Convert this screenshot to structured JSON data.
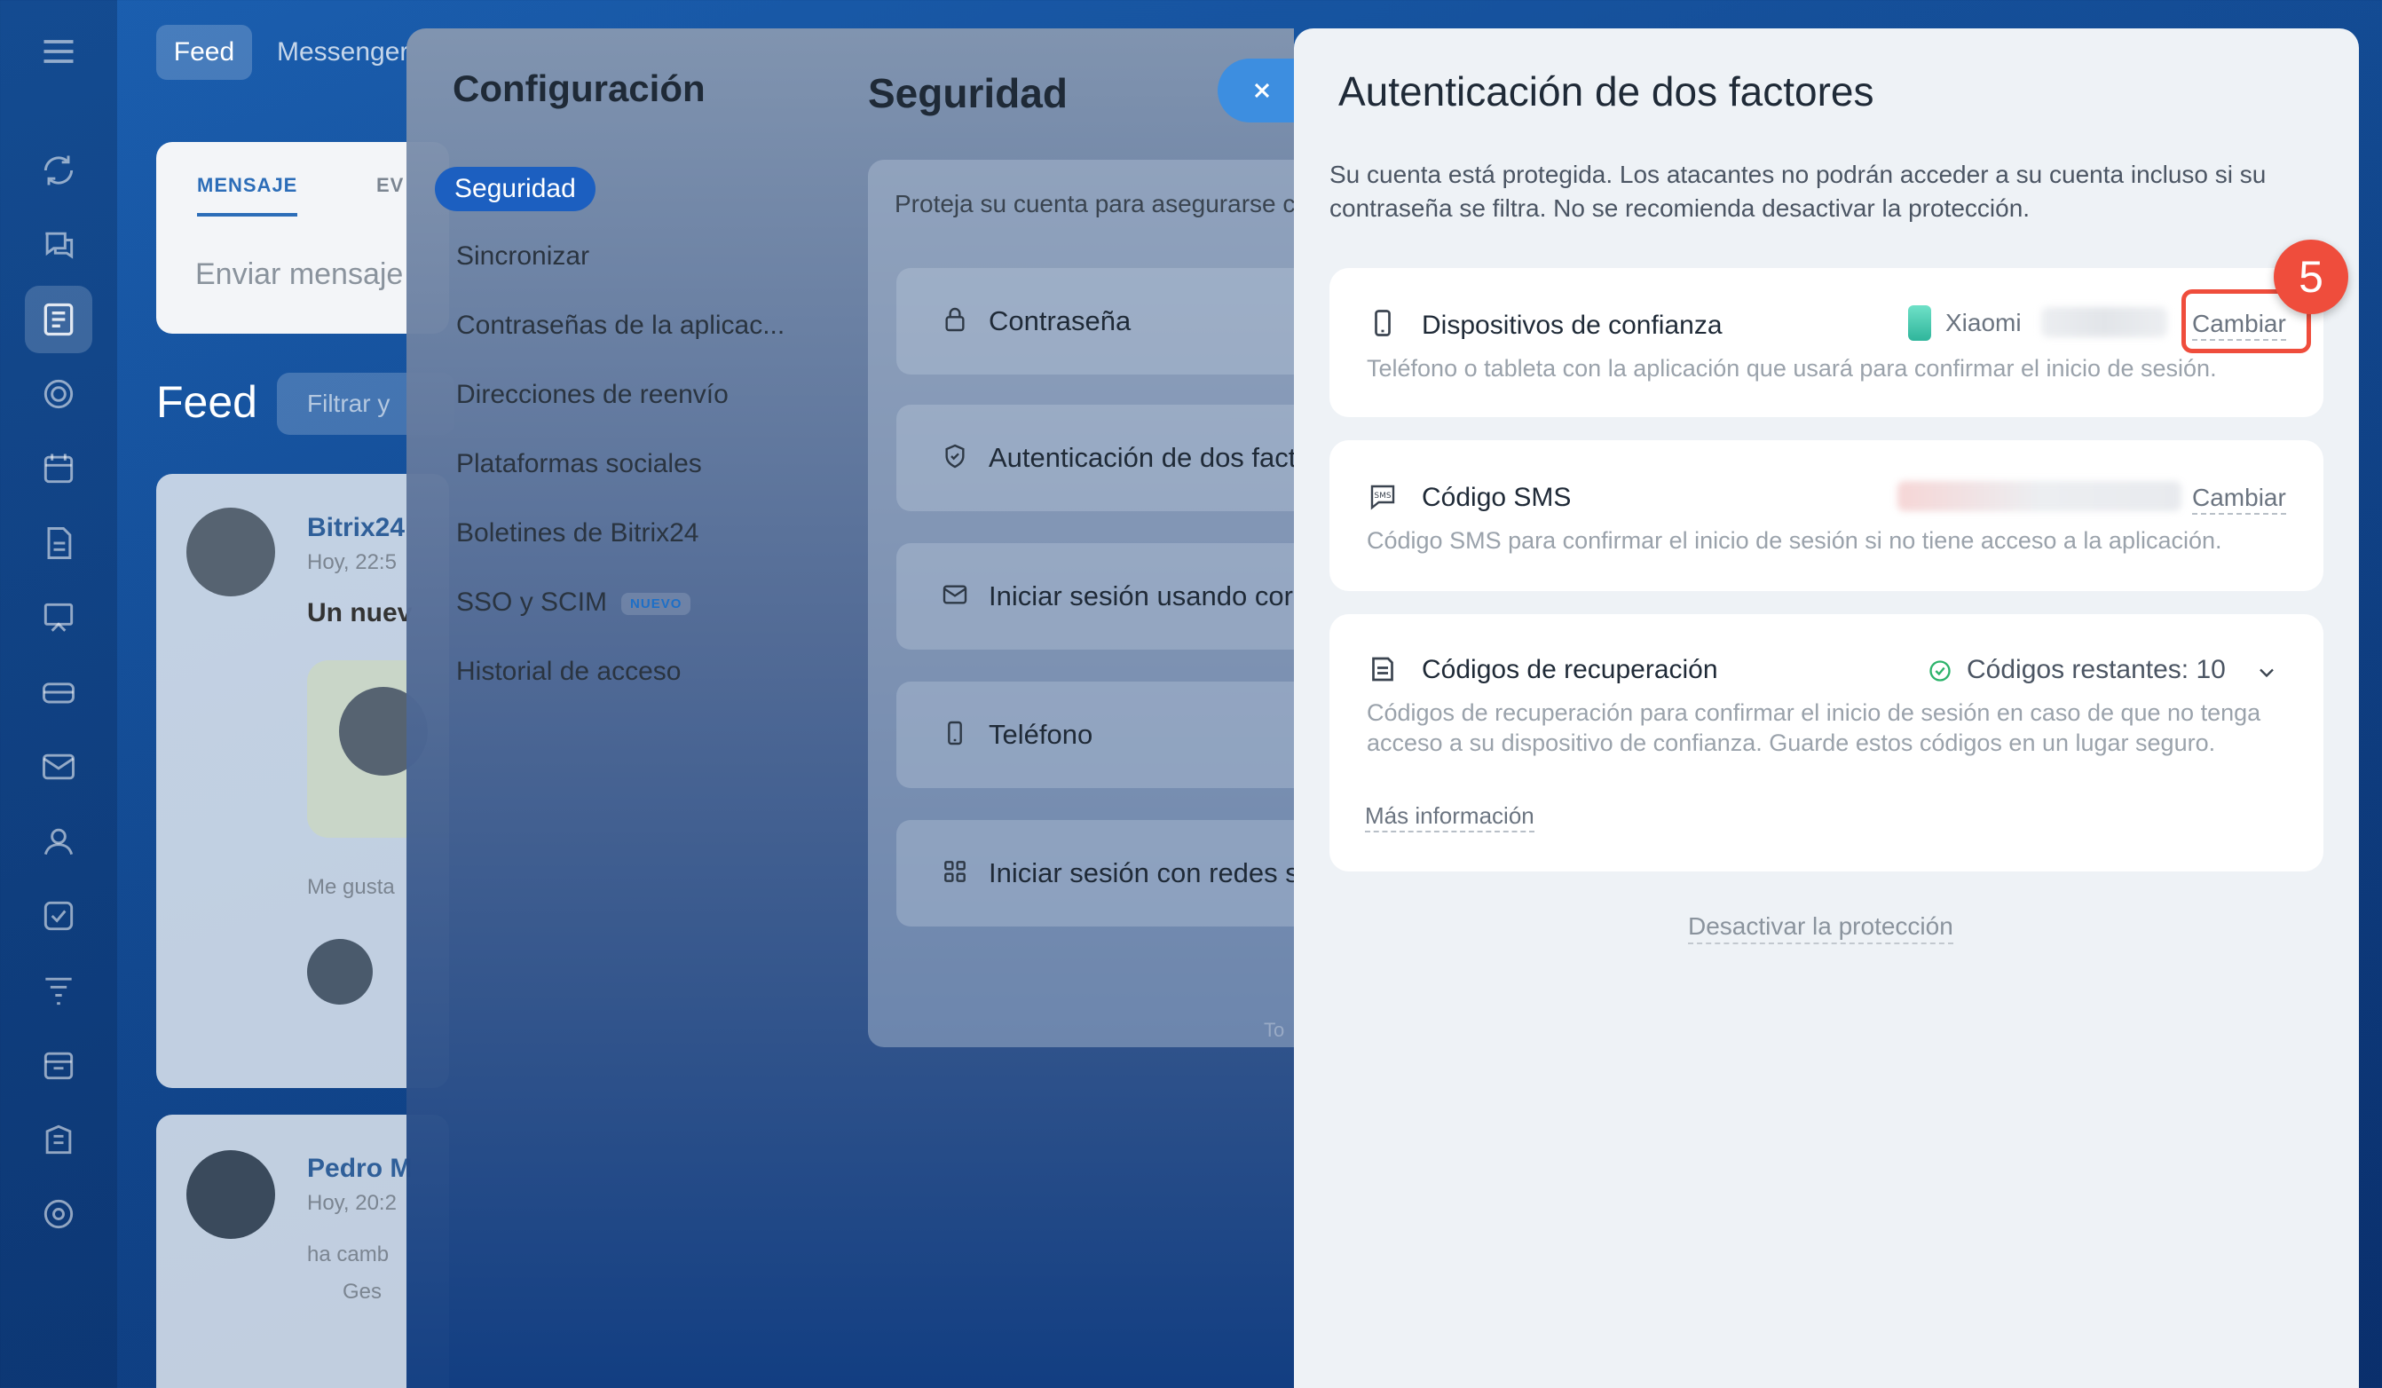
{
  "background": {
    "top_tabs": [
      "Feed",
      "Messenger"
    ],
    "composer": {
      "tabs": [
        "MENSAJE",
        "EV"
      ],
      "input_placeholder": "Enviar mensaje"
    },
    "feed": {
      "title": "Feed",
      "filter_placeholder": "Filtrar y"
    },
    "posts": [
      {
        "author": "Bitrix24",
        "time": "Hoy, 22:5",
        "text": "Un nuev",
        "likes": "Me gusta"
      },
      {
        "author": "Pedro M",
        "time": "Hoy, 20:2",
        "text": "ha camb",
        "extra": "Ges"
      }
    ]
  },
  "settings": {
    "title": "Configuración",
    "nav": [
      {
        "label": "Seguridad",
        "active": true
      },
      {
        "label": "Sincronizar"
      },
      {
        "label": "Contraseñas de la aplicac..."
      },
      {
        "label": "Direcciones de reenvío"
      },
      {
        "label": "Plataformas sociales"
      },
      {
        "label": "Boletines de Bitrix24"
      },
      {
        "label": "SSO y SCIM",
        "badge": "NUEVO"
      },
      {
        "label": "Historial de acceso"
      }
    ]
  },
  "security": {
    "title": "Seguridad",
    "description": "Proteja su cuenta para asegurarse c",
    "rows": [
      {
        "label": "Contraseña",
        "icon": "lock-icon"
      },
      {
        "label": "Autenticación de dos fact",
        "icon": "shield-icon"
      },
      {
        "label": "Iniciar sesión usando corr",
        "icon": "envelope-icon"
      },
      {
        "label": "Teléfono",
        "icon": "phone-icon"
      },
      {
        "label": "Iniciar sesión con redes s",
        "icon": "grid-icon"
      }
    ],
    "footer_fragment": "To"
  },
  "two_factor": {
    "title": "Autenticación de dos factores",
    "description": "Su cuenta está protegida. Los atacantes no podrán acceder a su cuenta incluso si su contraseña se filtra. No se recomienda desactivar la protección.",
    "trusted_devices": {
      "title": "Dispositivos de confianza",
      "device": "Xiaomi",
      "action": "Cambiar",
      "description": "Teléfono o tableta con la aplicación que usará para confirmar el inicio de sesión."
    },
    "sms": {
      "title": "Código SMS",
      "action": "Cambiar",
      "description": "Código SMS para confirmar el inicio de sesión si no tiene acceso a la aplicación."
    },
    "recovery": {
      "title": "Códigos de recuperación",
      "remaining": "Códigos restantes: 10",
      "description": "Códigos de recuperación para confirmar el inicio de sesión en caso de que no tenga acceso a su dispositivo de confianza. Guarde estos códigos en un lugar seguro.",
      "more_info": "Más información"
    },
    "deactivate": "Desactivar la protección",
    "step_marker": "5"
  },
  "colors": {
    "accent": "#1c5fc0",
    "highlight": "#ef4d3c",
    "success": "#2db36b"
  }
}
